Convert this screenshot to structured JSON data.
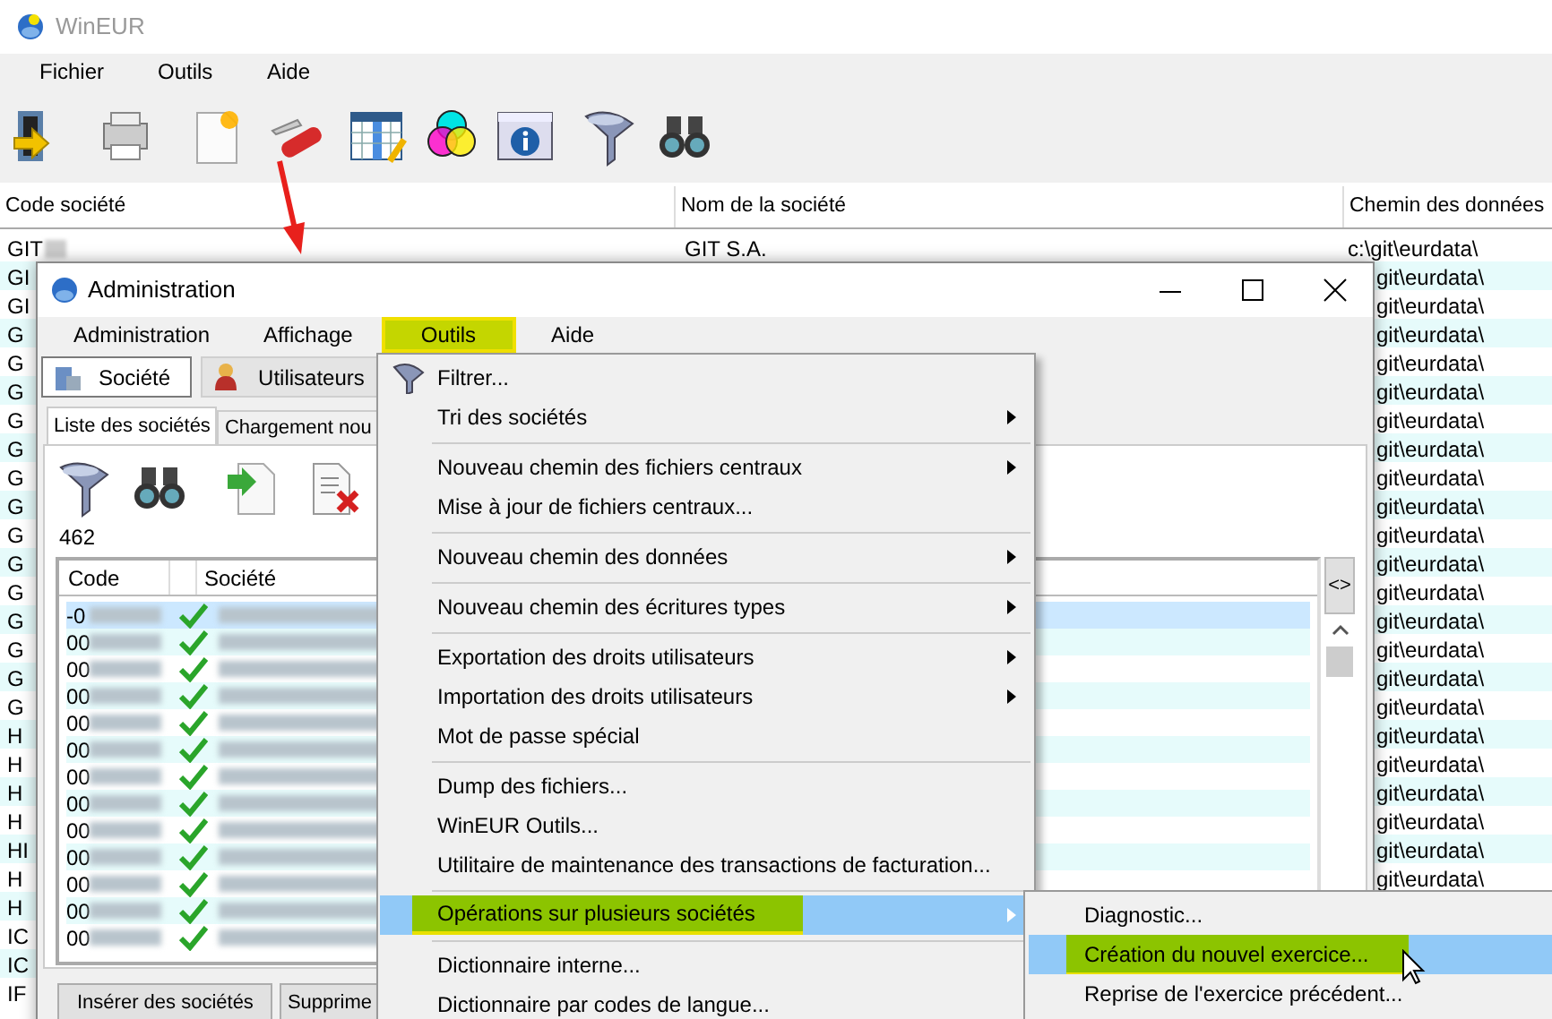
{
  "main_window": {
    "title": "WinEUR",
    "menu": [
      {
        "label": "Fichier"
      },
      {
        "label": "Outils"
      },
      {
        "label": "Aide"
      }
    ],
    "table": {
      "columns": [
        "Code société",
        "Nom de la société",
        "Chemin des données"
      ],
      "rows": [
        {
          "code": "GIT",
          "redacted": true,
          "name": "GIT S.A.",
          "path": "c:\\git\\eurdata\\"
        },
        {
          "code": "GI",
          "redacted": false,
          "path": "git\\eurdata\\"
        },
        {
          "code": "GI",
          "redacted": false,
          "path": "git\\eurdata\\"
        },
        {
          "code": "G",
          "redacted": false,
          "path": "git\\eurdata\\"
        },
        {
          "code": "G",
          "redacted": false,
          "path": "git\\eurdata\\"
        },
        {
          "code": "G",
          "redacted": false,
          "path": "git\\eurdata\\"
        },
        {
          "code": "G",
          "redacted": false,
          "path": "git\\eurdata\\"
        },
        {
          "code": "G",
          "redacted": false,
          "path": "git\\eurdata\\"
        },
        {
          "code": "G",
          "redacted": false,
          "path": "git\\eurdata\\"
        },
        {
          "code": "G",
          "redacted": false,
          "path": "git\\eurdata\\"
        },
        {
          "code": "G",
          "redacted": false,
          "path": "git\\eurdata\\"
        },
        {
          "code": "G",
          "redacted": false,
          "path": "git\\eurdata\\"
        },
        {
          "code": "G",
          "redacted": false,
          "path": "git\\eurdata\\"
        },
        {
          "code": "G",
          "redacted": false,
          "path": "git\\eurdata\\"
        },
        {
          "code": "G",
          "redacted": false,
          "path": "git\\eurdata\\"
        },
        {
          "code": "G",
          "redacted": false,
          "path": "git\\eurdata\\"
        },
        {
          "code": "G",
          "redacted": false,
          "path": "git\\eurdata\\"
        },
        {
          "code": "H",
          "redacted": false,
          "path": "git\\eurdata\\"
        },
        {
          "code": "H",
          "redacted": false,
          "path": "git\\eurdata\\"
        },
        {
          "code": "H",
          "redacted": false,
          "path": "git\\eurdata\\"
        },
        {
          "code": "H",
          "redacted": false,
          "path": "git\\eurdata\\"
        },
        {
          "code": "HI",
          "redacted": false,
          "path": "git\\eurdata\\"
        },
        {
          "code": "H",
          "redacted": false,
          "path": "git\\eurdata\\"
        },
        {
          "code": "H",
          "redacted": false
        },
        {
          "code": "IC",
          "redacted": false
        },
        {
          "code": "IC",
          "redacted": false
        },
        {
          "code": "IF",
          "redacted": false
        }
      ]
    }
  },
  "admin_window": {
    "title": "Administration",
    "menu": [
      {
        "label": "Administration",
        "selected": false
      },
      {
        "label": "Affichage",
        "selected": false
      },
      {
        "label": "Outils",
        "selected": true
      },
      {
        "label": "Aide",
        "selected": false
      }
    ],
    "tabs": [
      {
        "label": "Société",
        "selected": true
      },
      {
        "label": "Utilisateurs",
        "selected": false
      }
    ],
    "subtabs": [
      {
        "label": "Liste des sociétés",
        "selected": true
      },
      {
        "label": "Chargement nou",
        "selected": false
      }
    ],
    "count": "462",
    "list": {
      "columns": [
        "Code",
        "Société"
      ],
      "rows": [
        {
          "code": "-0",
          "checked": true,
          "selected": true
        },
        {
          "code": "00",
          "checked": true,
          "selected": false
        },
        {
          "code": "00",
          "checked": true,
          "selected": false
        },
        {
          "code": "00",
          "checked": true,
          "selected": false
        },
        {
          "code": "00",
          "checked": true,
          "selected": false
        },
        {
          "code": "00",
          "checked": true,
          "selected": false
        },
        {
          "code": "00",
          "checked": true,
          "selected": false
        },
        {
          "code": "00",
          "checked": true,
          "selected": false
        },
        {
          "code": "00",
          "checked": true,
          "selected": false
        },
        {
          "code": "00",
          "checked": true,
          "selected": false
        },
        {
          "code": "00",
          "checked": true,
          "selected": false
        },
        {
          "code": "00",
          "checked": true,
          "selected": false
        },
        {
          "code": "00",
          "checked": true,
          "selected": false
        }
      ]
    },
    "scroll_button": "<>",
    "buttons": [
      "Insérer des sociétés",
      "Supprime"
    ]
  },
  "tools_menu": {
    "items": [
      {
        "kind": "item",
        "label": "Filtrer...",
        "submenu": false,
        "selected": false
      },
      {
        "kind": "item",
        "label": "Tri des sociétés",
        "submenu": true,
        "selected": false
      },
      {
        "kind": "separator"
      },
      {
        "kind": "item",
        "label": "Nouveau chemin des fichiers centraux",
        "submenu": true,
        "selected": false
      },
      {
        "kind": "item",
        "label": "Mise à jour de fichiers centraux...",
        "submenu": false,
        "selected": false
      },
      {
        "kind": "separator"
      },
      {
        "kind": "item",
        "label": "Nouveau chemin des données",
        "submenu": true,
        "selected": false
      },
      {
        "kind": "separator"
      },
      {
        "kind": "item",
        "label": "Nouveau chemin des écritures types",
        "submenu": true,
        "selected": false
      },
      {
        "kind": "separator"
      },
      {
        "kind": "item",
        "label": "Exportation des droits utilisateurs",
        "submenu": true,
        "selected": false
      },
      {
        "kind": "item",
        "label": "Importation des droits utilisateurs",
        "submenu": true,
        "selected": false
      },
      {
        "kind": "item",
        "label": "Mot de passe spécial",
        "submenu": false,
        "selected": false
      },
      {
        "kind": "separator"
      },
      {
        "kind": "item",
        "label": "Dump des fichiers...",
        "submenu": false,
        "selected": false
      },
      {
        "kind": "item",
        "label": "WinEUR Outils...",
        "submenu": false,
        "selected": false
      },
      {
        "kind": "item",
        "label": "Utilitaire de maintenance des transactions de facturation...",
        "submenu": false,
        "selected": false
      },
      {
        "kind": "separator"
      },
      {
        "kind": "item",
        "label": "Opérations sur plusieurs sociétés",
        "submenu": true,
        "selected": true
      },
      {
        "kind": "separator"
      },
      {
        "kind": "item",
        "label": "Dictionnaire interne...",
        "submenu": false,
        "selected": false
      },
      {
        "kind": "item",
        "label": "Dictionnaire par codes de langue...",
        "submenu": false,
        "selected": false
      }
    ]
  },
  "submenu": {
    "items": [
      {
        "label": "Diagnostic...",
        "selected": false
      },
      {
        "label": "Création du nouvel exercice...",
        "selected": true
      },
      {
        "label": "Reprise de l'exercice précédent...",
        "selected": false
      }
    ]
  }
}
